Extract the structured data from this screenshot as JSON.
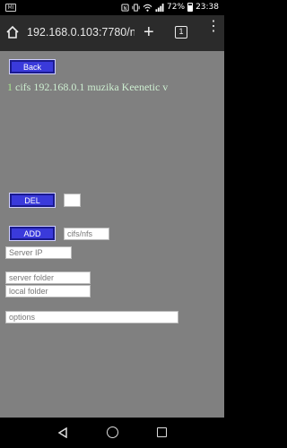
{
  "status_bar": {
    "notification_label": "MI",
    "battery": "72%",
    "time": "23:38"
  },
  "browser": {
    "url": "192.168.0.103:7780/n",
    "tab_count": "1",
    "plus": "+",
    "menu": "⋮"
  },
  "page": {
    "back_label": "Back",
    "entry_number": "1",
    "entry_text": " cifs 192.168.0.1 muzika Keenetic v",
    "del_label": "DEL",
    "del_value": "",
    "add_label": "ADD",
    "type_placeholder": "cifs/nfs",
    "server_ip_placeholder": "Server IP",
    "server_folder_placeholder": "server folder",
    "local_folder_placeholder": "local folder",
    "options_placeholder": "options"
  },
  "colors": {
    "page_bg": "#808080",
    "button_bg": "#3a3adb",
    "entry_text": "#cdeed0"
  }
}
